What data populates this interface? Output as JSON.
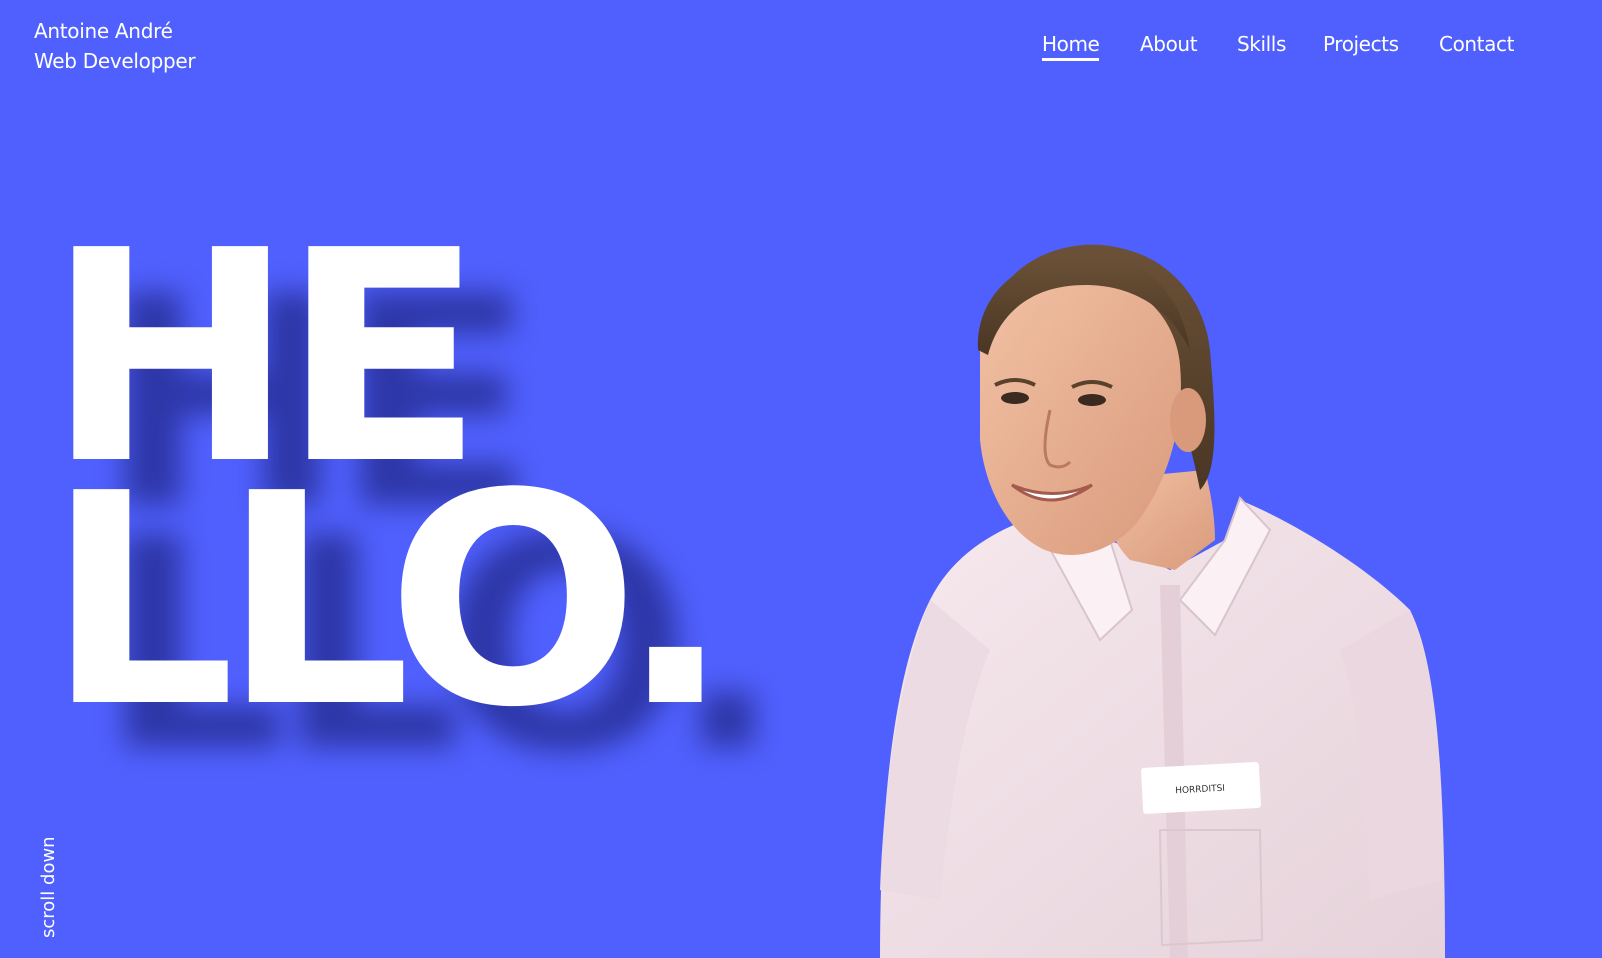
{
  "header": {
    "name": "Antoine André",
    "role": "Web Developper"
  },
  "nav": {
    "items": [
      "Home",
      "About",
      "Skills",
      "Projects",
      "Contact"
    ],
    "active": "Home"
  },
  "hero": {
    "line1": "HE",
    "line2": "LLO.",
    "scroll_hint": "scroll down",
    "portrait_badge": "HORRDITSI"
  },
  "colors": {
    "background": "#5060fe",
    "text": "#ffffff",
    "shadow": "#22298a"
  },
  "icons": {
    "portrait": "person-photo"
  }
}
